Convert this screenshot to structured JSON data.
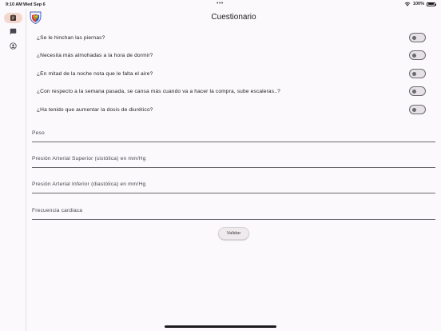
{
  "status_bar": {
    "time": "9:10 AM",
    "date": "Wed Sep 6",
    "dots": "•••",
    "battery": "100%"
  },
  "rail": {
    "items": [
      {
        "icon": "clipboard-icon",
        "active": true
      },
      {
        "icon": "chat-icon",
        "active": false
      },
      {
        "icon": "account-icon",
        "active": false
      }
    ]
  },
  "app_bar": {
    "title": "Cuestionario"
  },
  "questions": [
    {
      "label": "¿Se le hinchan las piernas?",
      "checked": false
    },
    {
      "label": "¿Necesita más almohadas a la hora de dormir?",
      "checked": false
    },
    {
      "label": "¿En mitad de la noche nota que le falta el aire?",
      "checked": false
    },
    {
      "label": "¿Con respecto a la semana pasada, se cansa más cuando va a hacer la compra, sube escaleras..?",
      "checked": false
    },
    {
      "label": "¿Ha tenido que aumentar la dosis de diurético?",
      "checked": false
    }
  ],
  "fields": [
    {
      "label": "Peso",
      "value": ""
    },
    {
      "label": "Presión Arterial Superior (sistólica) en mm/Hg",
      "value": ""
    },
    {
      "label": "Presión Arterial Inferior (diastólica) en mm/Hg",
      "value": ""
    },
    {
      "label": "Frecuencia cardiaca",
      "value": ""
    }
  ],
  "submit_label": "Validar",
  "colors": {
    "background": "#fbf9fb",
    "rail_active": "#f3d7cd",
    "toggle_border": "#6b6a6e"
  }
}
